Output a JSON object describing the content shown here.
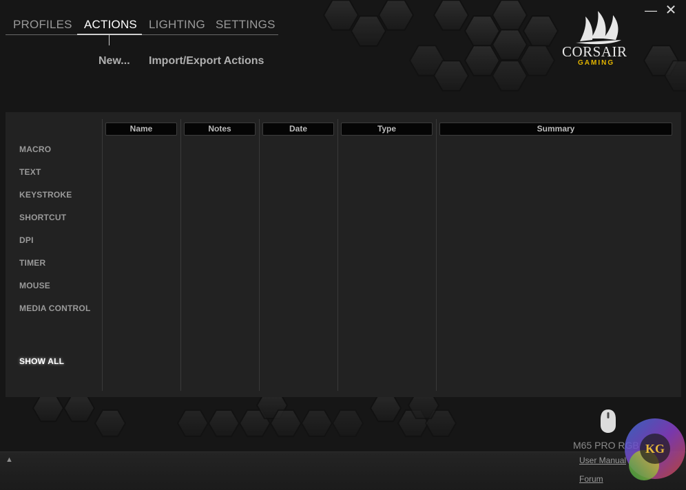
{
  "window": {
    "minimize_glyph": "—",
    "close_glyph": "✕"
  },
  "tabs": [
    {
      "label": "PROFILES",
      "active": false
    },
    {
      "label": "ACTIONS",
      "active": true
    },
    {
      "label": "LIGHTING",
      "active": false
    },
    {
      "label": "SETTINGS",
      "active": false
    }
  ],
  "sub_actions": {
    "new_label": "New...",
    "import_export_label": "Import/Export Actions"
  },
  "brand": {
    "name": "CORSAIR",
    "sub": "GAMING",
    "accent_color": "#e3b500",
    "logo_icon": "corsair-sails-icon"
  },
  "categories": [
    "MACRO",
    "TEXT",
    "KEYSTROKE",
    "SHORTCUT",
    "DPI",
    "TIMER",
    "MOUSE",
    "MEDIA CONTROL"
  ],
  "show_all_label": "SHOW ALL",
  "table": {
    "columns": [
      "Name",
      "Notes",
      "Date",
      "Type",
      "Summary"
    ],
    "rows": []
  },
  "device": {
    "name": "M65 PRO RGB",
    "icon": "mouse-icon"
  },
  "footer": {
    "expand_icon": "triangle-up-icon",
    "expand_glyph": "▲",
    "user_manual_label": "User Manual",
    "forum_label": "Forum"
  },
  "watermark": {
    "text": "KG",
    "icon": "kg-badge-icon"
  }
}
